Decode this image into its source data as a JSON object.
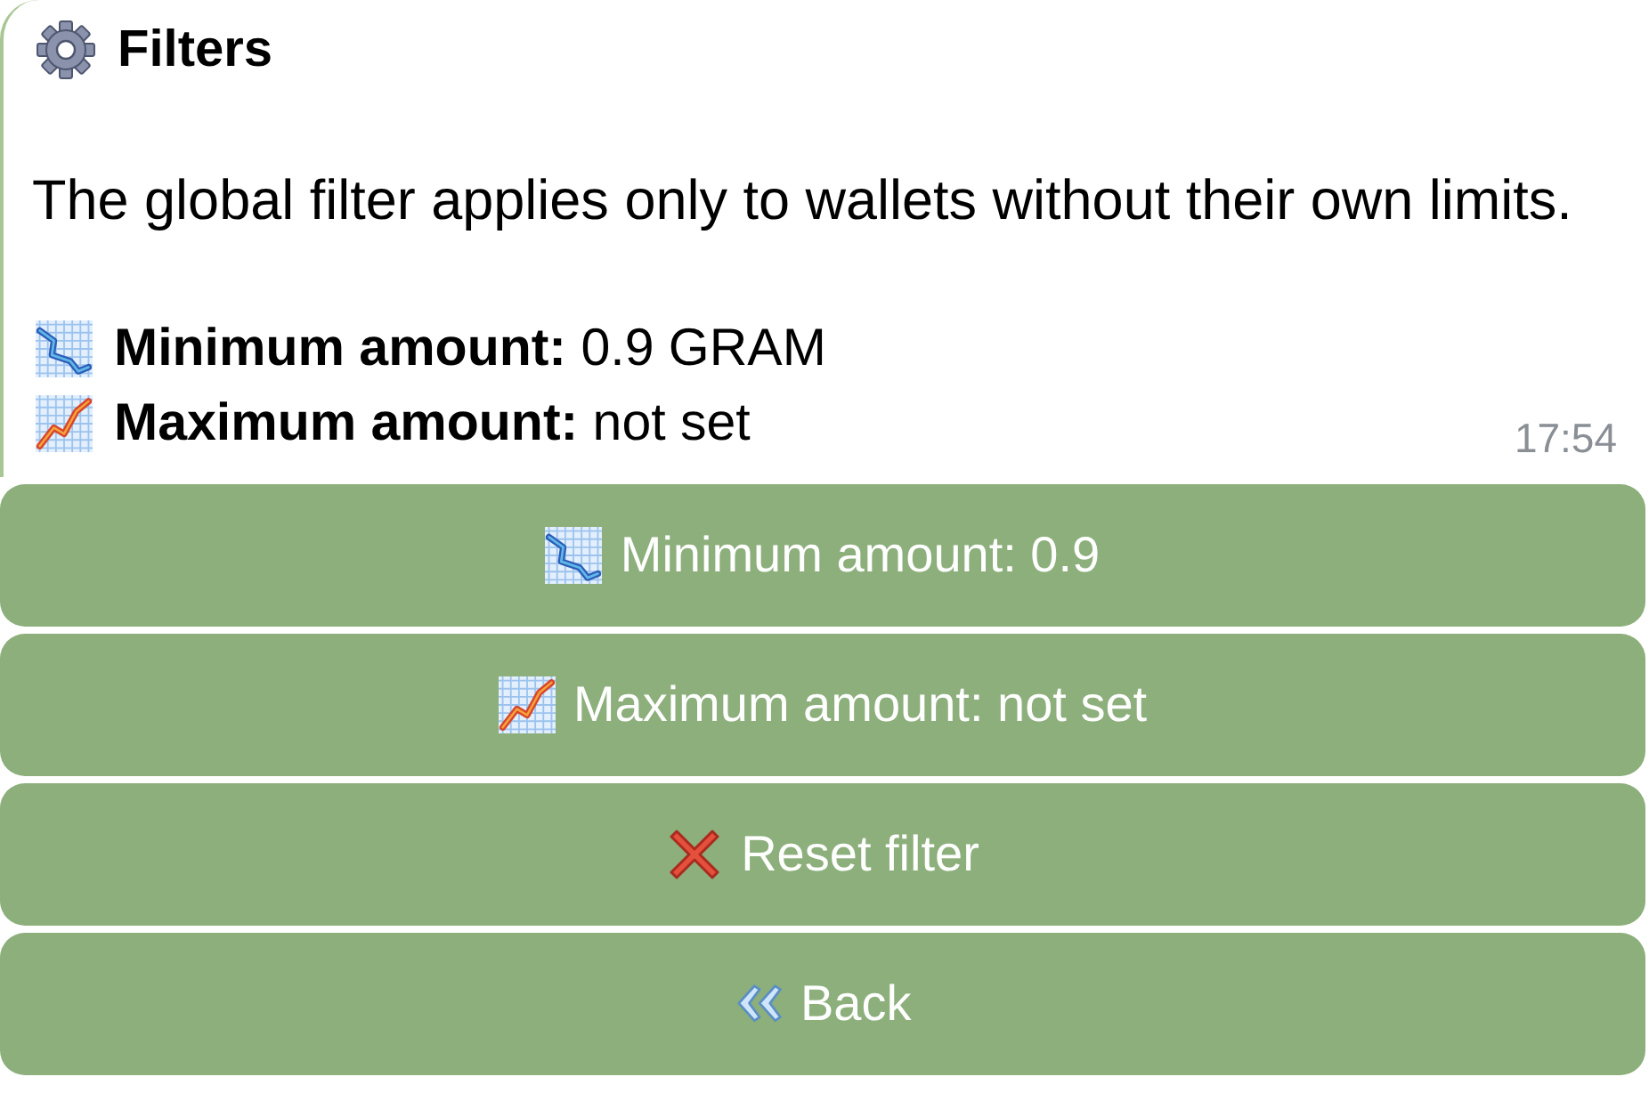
{
  "message": {
    "title": "Filters",
    "body": "The global filter applies only to wallets without their own limits.",
    "fields": [
      {
        "kind": "minimum",
        "text": "**Minimum amount:** 0.9 GRAM"
      },
      {
        "kind": "maximum",
        "text": "**Maximum amount:** not set"
      }
    ],
    "time": "17:54"
  },
  "buttons": [
    {
      "kind": "minimum",
      "label": "Minimum amount: 0.9"
    },
    {
      "kind": "maximum",
      "label": "Maximum amount: not set"
    },
    {
      "kind": "reset",
      "label": "Reset filter"
    },
    {
      "kind": "back",
      "label": "Back"
    }
  ]
}
